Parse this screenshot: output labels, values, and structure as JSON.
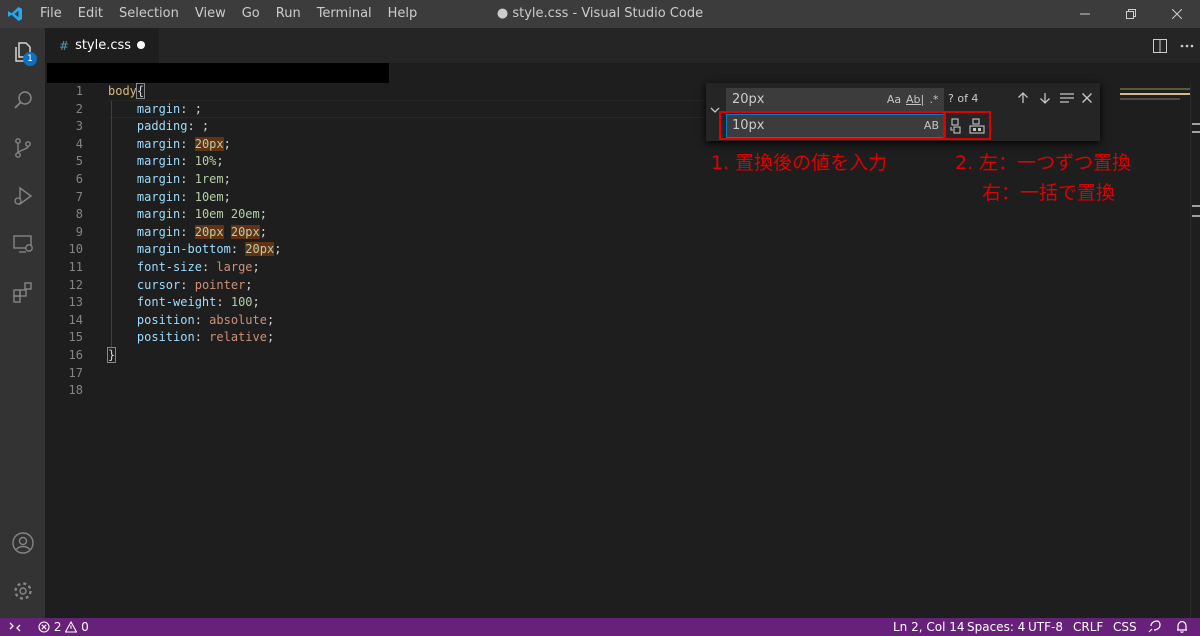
{
  "titlebar": {
    "menu": [
      "File",
      "Edit",
      "Selection",
      "View",
      "Go",
      "Run",
      "Terminal",
      "Help"
    ],
    "window_title": "● style.css - Visual Studio Code"
  },
  "tab": {
    "icon": "#",
    "name": "style.css"
  },
  "activitybar": {
    "badge": "1"
  },
  "editor": {
    "line_numbers": [
      "1",
      "2",
      "3",
      "4",
      "5",
      "6",
      "7",
      "8",
      "9",
      "10",
      "11",
      "12",
      "13",
      "14",
      "15",
      "16",
      "17",
      "18"
    ]
  },
  "find": {
    "search_value": "20px",
    "option_case": "Aa",
    "option_word": "Ab|",
    "option_regex": ".*",
    "match_count": "? of 4",
    "replace_value": "10px",
    "preserve_case": "AB"
  },
  "annotations": {
    "step1": "1. 置換後の値を入力",
    "step2_line1": "2. 左：一つずつ置換",
    "step2_line2": "右：一括で置換"
  },
  "statusbar": {
    "errors": "2",
    "warnings": "0",
    "position": "Ln 2, Col 14",
    "spaces": "Spaces: 4",
    "encoding": "UTF-8",
    "eol": "CRLF",
    "language": "CSS"
  },
  "colors": {
    "statusbar": "#68217a",
    "accent": "#007acc",
    "annotation": "#e00000",
    "match_highlight": "#613214"
  }
}
